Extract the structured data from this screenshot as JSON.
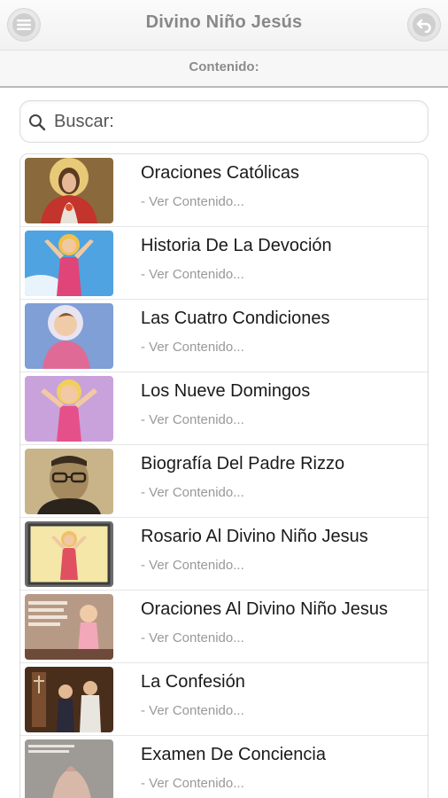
{
  "header": {
    "title": "Divino Niño Jesús",
    "menu_icon": "menu-icon",
    "back_icon": "back-arrow-icon"
  },
  "subheader": {
    "title": "Contenido:"
  },
  "search": {
    "placeholder": "Buscar:",
    "value": "",
    "icon": "search-icon"
  },
  "list": {
    "items": [
      {
        "title": "Oraciones Católicas",
        "subtitle": "- Ver Contenido...",
        "thumb": "jesus-sacred-heart"
      },
      {
        "title": "Historia De La Devoción",
        "subtitle": "- Ver Contenido...",
        "thumb": "divino-nino-sky"
      },
      {
        "title": "Las Cuatro Condiciones",
        "subtitle": "- Ver Contenido...",
        "thumb": "divino-nino-blue"
      },
      {
        "title": "Los Nueve Domingos",
        "subtitle": "- Ver Contenido...",
        "thumb": "divino-nino-pink"
      },
      {
        "title": "Biografía Del Padre Rizzo",
        "subtitle": "- Ver Contenido...",
        "thumb": "padre-rizzo-photo"
      },
      {
        "title": "Rosario Al Divino Niño Jesus",
        "subtitle": "- Ver Contenido...",
        "thumb": "divino-nino-framed"
      },
      {
        "title": "Oraciones Al Divino Niño Jesus",
        "subtitle": "- Ver Contenido...",
        "thumb": "divino-nino-prayer-card"
      },
      {
        "title": "La Confesión",
        "subtitle": "- Ver Contenido...",
        "thumb": "confession-scene"
      },
      {
        "title": "Examen De Conciencia",
        "subtitle": "- Ver Contenido...",
        "thumb": "praying-hands"
      }
    ]
  },
  "colors": {
    "header_text": "#888888",
    "item_title": "#1a1a1a",
    "item_subtitle": "#999999"
  }
}
